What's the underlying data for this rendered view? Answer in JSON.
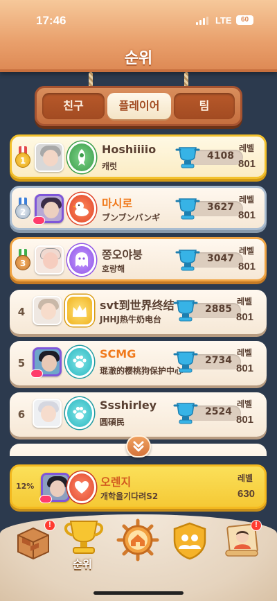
{
  "status_bar": {
    "time": "17:46",
    "network": "LTE",
    "battery": "60"
  },
  "header": {
    "title": "순위"
  },
  "tabs": [
    {
      "label": "친구",
      "selected": false
    },
    {
      "label": "플레이어",
      "selected": true
    },
    {
      "label": "팀",
      "selected": false
    }
  ],
  "leaderboard": {
    "level_label": "레벨",
    "rows": [
      {
        "rank": "1",
        "name": "Hoshiiiio",
        "subtitle": "캐럿",
        "trophies": "4108",
        "level": "801"
      },
      {
        "rank": "2",
        "name": "마시로",
        "subtitle": "ブンブンバンギ",
        "trophies": "3627",
        "level": "801"
      },
      {
        "rank": "3",
        "name": "쫑오야붕",
        "subtitle": "호랑해",
        "trophies": "3047",
        "level": "801"
      },
      {
        "rank": "4",
        "name": "svt到世界终结",
        "subtitle": "JHHJ热牛奶电台",
        "trophies": "2885",
        "level": "801"
      },
      {
        "rank": "5",
        "name": "SCMG",
        "subtitle": "琨澈的樱桃狗保护中心",
        "trophies": "2734",
        "level": "801"
      },
      {
        "rank": "6",
        "name": "Ssshirley",
        "subtitle": "圆碩民",
        "trophies": "2524",
        "level": "801"
      }
    ]
  },
  "my_row": {
    "percentile": "12%",
    "name": "오렌지",
    "subtitle": "개학을기다려S2",
    "level_label": "레벨",
    "level": "630"
  },
  "bottom_nav": {
    "items": [
      {
        "icon": "board-box-icon",
        "label": "",
        "alert": "!"
      },
      {
        "icon": "trophy-icon",
        "label": "순위",
        "alert": ""
      },
      {
        "icon": "home-wheel-icon",
        "label": "",
        "alert": ""
      },
      {
        "icon": "team-shield-icon",
        "label": "",
        "alert": ""
      },
      {
        "icon": "scroll-avatar-icon",
        "label": "",
        "alert": "!"
      }
    ]
  },
  "colors": {
    "accent_orange": "#de8a55",
    "gold": "#f3c12c",
    "silver": "#a9bcd0",
    "bronze": "#f0a443",
    "highlight_name": "#f07a1c"
  }
}
